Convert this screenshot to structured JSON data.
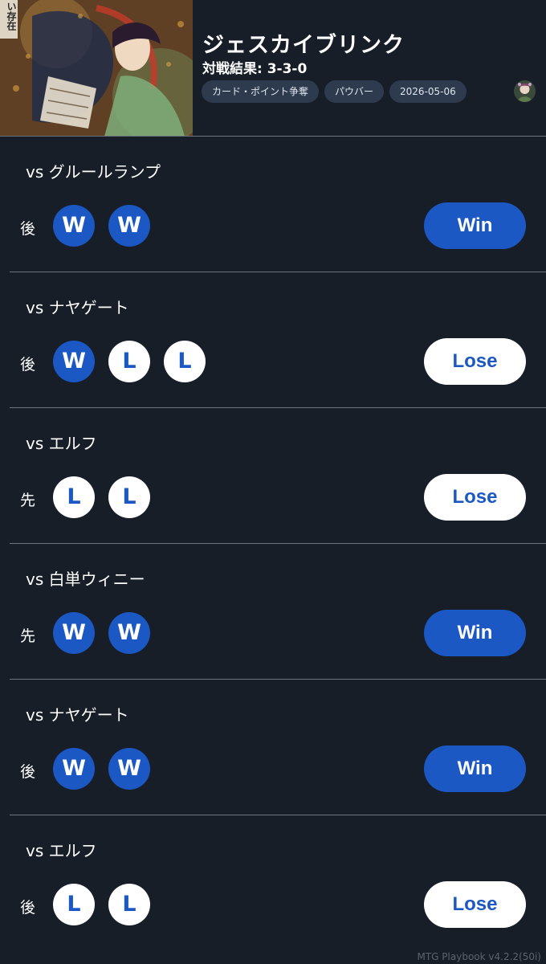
{
  "deck": {
    "cover_caption": "い存在",
    "title": "ジェスカイブリンク",
    "record": "対戦結果: 3-3-0",
    "tags": [
      "カード・ポイント争奪",
      "パウバー",
      "2026-05-06"
    ]
  },
  "matches": [
    {
      "opponent": "vs グルールランプ",
      "order": "後",
      "games": [
        "W",
        "W"
      ],
      "result": "Win"
    },
    {
      "opponent": "vs ナヤゲート",
      "order": "後",
      "games": [
        "W",
        "L",
        "L"
      ],
      "result": "Lose"
    },
    {
      "opponent": "vs エルフ",
      "order": "先",
      "games": [
        "L",
        "L"
      ],
      "result": "Lose"
    },
    {
      "opponent": "vs 白単ウィニー",
      "order": "先",
      "games": [
        "W",
        "W"
      ],
      "result": "Win"
    },
    {
      "opponent": "vs ナヤゲート",
      "order": "後",
      "games": [
        "W",
        "W"
      ],
      "result": "Win"
    },
    {
      "opponent": "vs エルフ",
      "order": "後",
      "games": [
        "L",
        "L"
      ],
      "result": "Lose"
    }
  ],
  "footer": {
    "version": "MTG Playbook v4.2.2(50i)"
  },
  "colors": {
    "background": "#171e28",
    "tag_background": "#2e3b4f",
    "accent_blue": "#1c58c4",
    "divider": "#6c737c"
  }
}
